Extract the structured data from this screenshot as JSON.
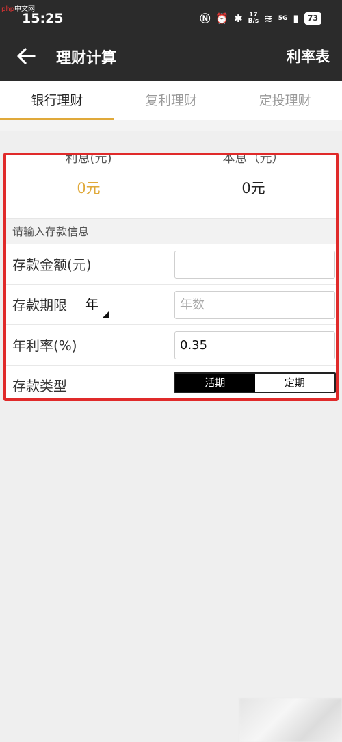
{
  "watermark": {
    "brand": "php",
    "text": "中文网"
  },
  "status_bar": {
    "time": "15:25",
    "net_speed_top": "17",
    "net_speed_bottom": "B/s",
    "network": "5G",
    "battery": "73"
  },
  "app_bar": {
    "title": "理财计算",
    "action": "利率表",
    "back_icon": "arrow-left-icon"
  },
  "tabs": [
    {
      "label": "银行理财",
      "active": true
    },
    {
      "label": "复利理财",
      "active": false
    },
    {
      "label": "定投理财",
      "active": false
    }
  ],
  "results": {
    "interest_label": "利息(元)",
    "interest_value": "0元",
    "principal_label": "本息（元）",
    "principal_value": "0元"
  },
  "form": {
    "section_title": "请输入存款信息",
    "amount_label": "存款金额(元)",
    "amount_value": "",
    "term_label": "存款期限",
    "term_unit": "年",
    "term_placeholder": "年数",
    "rate_label": "年利率(%)",
    "rate_value": "0.35",
    "type_label": "存款类型",
    "type_options": [
      "活期",
      "定期"
    ],
    "type_selected": "活期"
  },
  "colors": {
    "accent": "#e0a93a",
    "highlight_border": "#e02a2a",
    "appbar": "#2b2b2b"
  }
}
